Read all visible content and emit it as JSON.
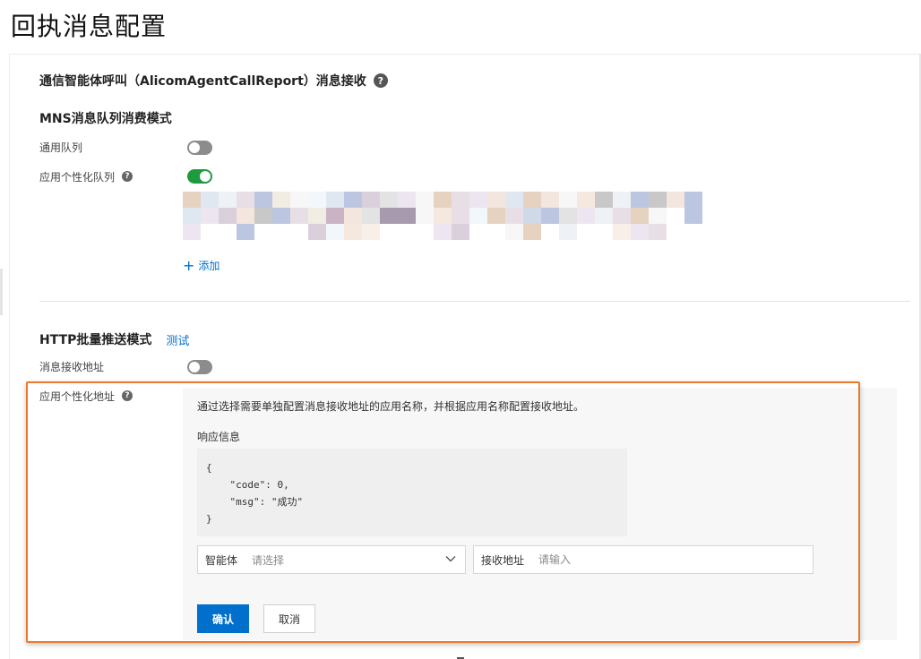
{
  "page": {
    "title": "回执消息配置"
  },
  "section": {
    "title": "通信智能体呼叫（AlicomAgentCallReport）消息接收",
    "help_icon": "question-circle-icon"
  },
  "mns": {
    "title": "MNS消息队列消费模式",
    "general_queue": {
      "label": "通用队列",
      "enabled": false
    },
    "app_queue": {
      "label": "应用个性化队列",
      "enabled": true
    },
    "add_label": "添加"
  },
  "http": {
    "title": "HTTP批量推送模式",
    "test_label": "测试",
    "receive_address": {
      "label": "消息接收地址",
      "enabled": false
    },
    "app_address": {
      "label": "应用个性化地址",
      "description": "通过选择需要单独配置消息接收地址的应用名称，并根据应用名称配置接收地址。",
      "response_label": "响应信息",
      "response_code": "{\n    \"code\": 0,\n    \"msg\": \"成功\"\n}",
      "agent_select": {
        "label": "智能体",
        "placeholder": "请选择"
      },
      "address_input": {
        "label": "接收地址",
        "placeholder": "请输入"
      },
      "confirm_label": "确认",
      "cancel_label": "取消"
    }
  },
  "colors": {
    "accent": "#0070cc",
    "switch_on": "#1f9a3e",
    "switch_off": "#8c8c8c",
    "highlight_border": "#ec7a2b"
  }
}
